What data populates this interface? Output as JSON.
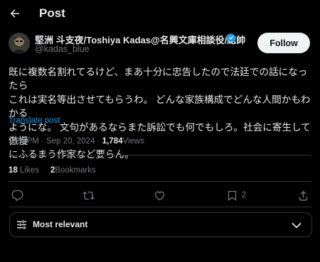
{
  "header": {
    "title": "Post"
  },
  "author": {
    "name": "堅洲 斗支夜/Toshiya Kadas@名興文庫相談役/総帥",
    "handle": "@kadas_blue",
    "follow_label": "Follow"
  },
  "post": {
    "lines": [
      "既に複数名割れてるけど、まあ十分に忠告したので法廷での話になったら",
      "これは実名等出させてもらうわ。 どんな家族構成でどんな人間かもわかる",
      "ようにな。 文句があるならまた訴訟でも何でもしろ。社会に寄生して傲慢",
      "にふるまう作家など要らん。"
    ],
    "translate_label": "Translate post",
    "timestamp": "9:29 PM · Sep 20, 2024 · ",
    "views_count": "1,784",
    "views_label": "Views"
  },
  "stats": {
    "likes_count": "18",
    "likes_label": "Likes",
    "bookmarks_count": "2",
    "bookmarks_label": "Bookmarks"
  },
  "actions": {
    "bookmark_count": "2"
  },
  "replies_sort": {
    "label": "Most relevant"
  },
  "colors": {
    "background": "#000000",
    "text": "#e7e9ea",
    "muted": "#71767b",
    "link": "#1d9bf0",
    "verified": "#1d9bf0",
    "border": "#2f3336"
  },
  "icons": [
    "back-arrow-icon",
    "verified-badge-icon",
    "reply-icon",
    "repost-icon",
    "like-icon",
    "bookmark-icon",
    "share-icon",
    "sort-sliders-icon",
    "chevron-down-icon"
  ]
}
